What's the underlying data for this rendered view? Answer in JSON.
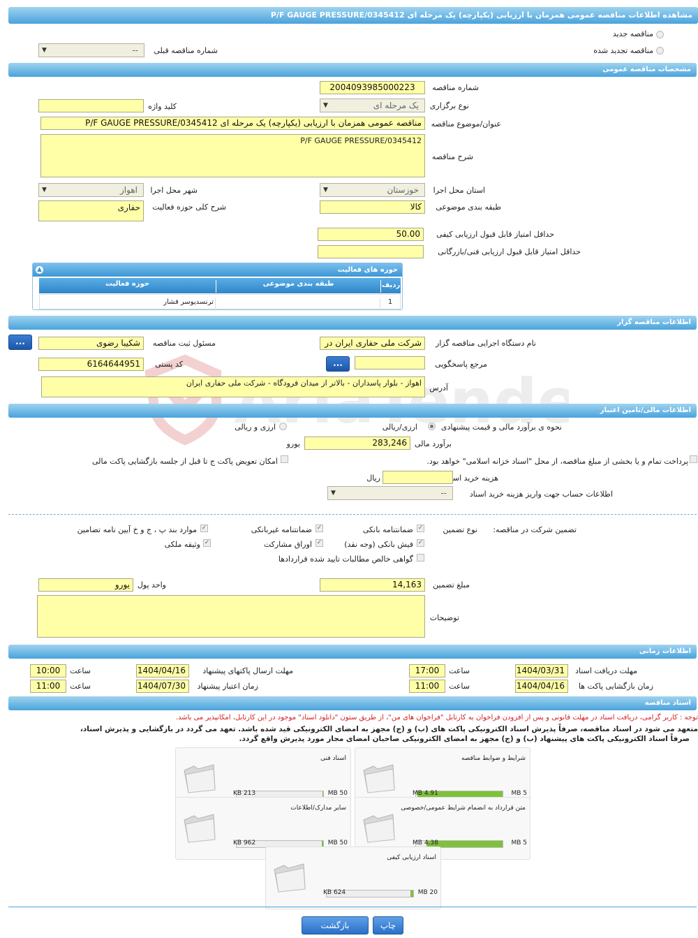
{
  "title": "مشاهده اطلاعات مناقصه عمومی همزمان با ارزیابی (یکپارچه) یک مرحله ای P/F GAUGE PRESSURE/0345412",
  "top": {
    "radio_new": "مناقصه جدید",
    "radio_renew": "مناقصه تجدید شده",
    "prev_label": "شماره مناقصه قبلی",
    "prev_value": "--"
  },
  "general": {
    "header": "مشخصات مناقصه عمومی",
    "number_label": "شماره مناقصه",
    "number": "2004093985000223",
    "type_label": "نوع برگزاری",
    "type": "یک مرحله ای",
    "keyword_label": "کلید واژه",
    "keyword": "",
    "subject_label": "عنوان/موضوع مناقصه",
    "subject": "مناقصه عمومی همزمان با ارزیابی (یکپارچه) یک مرحله ای P/F GAUGE PRESSURE/0345412",
    "desc_label": "شرح مناقصه",
    "desc": "P/F GAUGE PRESSURE/0345412",
    "province_label": "استان محل اجرا",
    "province": "خوزستان",
    "city_label": "شهر محل اجرا",
    "city": "اهواز",
    "category_label": "طبقه بندی موضوعی",
    "category": "کالا",
    "scope_label": "شرح کلی حوزه فعالیت",
    "scope": "حفاری",
    "min_quality_label": "حداقل امتیاز قابل قبول ارزیابی کیفی",
    "min_quality": "50.00",
    "min_tech_label": "حداقل امتیاز قابل قبول ارزیابی فنی/بازرگانی",
    "min_tech": ""
  },
  "activity": {
    "header": "حوزه های فعالیت",
    "cols": [
      "ردیف",
      "طبقه بندی موضوعی",
      "حوزه فعالیت"
    ],
    "rows": [
      [
        "1",
        "ترنسدیوسر فشار",
        ""
      ]
    ]
  },
  "org": {
    "header": "اطلاعات مناقصه گزار",
    "name_label": "نام دستگاه اجرایی مناقصه گزار",
    "name": "شرکت ملی حفاری ایران در",
    "resp_label": "مسئول ثبت مناقصه",
    "resp": "شکیبا رضوی",
    "ref_label": "مرجع پاسخگویی",
    "ref": "",
    "postal_label": "کد پستی",
    "postal": "6164644951",
    "addr_label": "آدرس",
    "addr": "اهواز - بلوار پاسداران - بالاتر از میدان فرودگاه - شرکت ملی حفاری ایران",
    "btn": "..."
  },
  "finance": {
    "header": "اطلاعات مالی/تامین اعتبار",
    "estimate_method_label": "نحوه ی برآورد مالی و قیمت پیشنهادی",
    "opt_currency": "ارزی/ریالی",
    "opt_both": "ارزی و ریالی",
    "estimate_label": "برآورد مالی",
    "estimate": "283,246",
    "estimate_unit": "یورو",
    "treasury_text": "پرداخت تمام و یا بخشی از مبلغ مناقصه، از محل \"اسناد خزانه اسلامی\" خواهد بود.",
    "swap_text": "امکان تعویض پاکت ج تا قبل از جلسه بازگشایی پاکت مالی",
    "doc_cost_label": "هزینه خرید اسناد",
    "doc_cost": "",
    "doc_cost_unit": "ریال",
    "account_label": "اطلاعات حساب جهت واریز هزینه خرید اسناد",
    "account": "--"
  },
  "guarantee": {
    "label": "تضمین شرکت در مناقصه:",
    "type_label": "نوع تضمین",
    "opts": [
      "ضمانتنامه بانکی",
      "ضمانتنامه غیربانکی",
      "موارد بند پ ، ج و خ آیین نامه تضامین",
      "فیش بانکی (وجه نقد)",
      "اوراق مشارکت",
      "وثیقه ملکی",
      "گواهی خالص مطالبات تایید شده قراردادها"
    ],
    "amount_label": "مبلغ تضمین",
    "amount": "14,163",
    "currency_label": "واحد پول",
    "currency": "یورو",
    "notes_label": "توضیحات",
    "notes": ""
  },
  "timing": {
    "header": "اطلاعات زمانی",
    "receive_label": "مهلت دریافت اسناد",
    "receive_date": "1404/03/31",
    "receive_time": "17:00",
    "submit_label": "مهلت ارسال پاکتهای پیشنهاد",
    "submit_date": "1404/04/16",
    "submit_time": "10:00",
    "open_label": "زمان بازگشایی پاکت ها",
    "open_date": "1404/04/16",
    "open_time": "11:00",
    "valid_label": "زمان اعتبار پیشنهاد",
    "valid_date": "1404/07/30",
    "valid_time": "11:00",
    "time_label": "ساعت"
  },
  "docs": {
    "header": "اسناد مناقصه",
    "note": "توجه : کاربر گرامی، دریافت اسناد در مهلت قانونی و پس از افزودن فراخوان به کارتابل \"فراخوان های من\"، از طریق ستون \"دانلود اسناد\" موجود در این کارتابل، امکانپذیر می باشد.",
    "commit1": "متعهد می شود در اسناد مناقصه، صرفاً پذیرش اسناد الکترونیکی پاکت های (ب) و (ج) مجهز به امضای الکترونیکی قید شده باشد. تعهد می گردد در بازگشایی و پذیرش اسناد،",
    "commit2": "صرفاً اسناد الکترونیکی پاکت های پیشنهاد (ب) و (ج) مجهز به امضای الکترونیکی صاحبان امضای مجاز مورد پذیرش واقع گردد.",
    "files": [
      {
        "name": "شرایط و ضوابط مناقصه",
        "size": "4.91 MB",
        "max": "5 MB",
        "fill": 0.98
      },
      {
        "name": "اسناد فنی",
        "size": "213 KB",
        "max": "50 MB",
        "fill": 0.004
      },
      {
        "name": "متن قرارداد به انضمام شرایط عمومی/خصوصی",
        "size": "4.38 MB",
        "max": "5 MB",
        "fill": 0.88
      },
      {
        "name": "سایر مدارک/اطلاعات",
        "size": "962 KB",
        "max": "50 MB",
        "fill": 0.02
      },
      {
        "name": "اسناد ارزیابی کیفی",
        "size": "624 KB",
        "max": "20 MB",
        "fill": 0.03
      }
    ]
  },
  "buttons": {
    "print": "چاپ",
    "back": "بازگشت"
  },
  "colors": {
    "header": "#4aa3dc",
    "input": "#ffffa8",
    "progress": "#7fc13a"
  }
}
